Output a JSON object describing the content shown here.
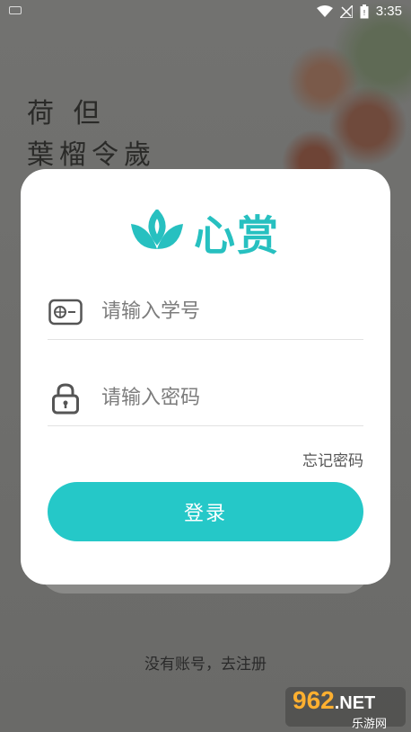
{
  "status_bar": {
    "time": "3:35"
  },
  "background": {
    "calligraphy_line1": "荷  但",
    "calligraphy_line2": "葉榴令歲"
  },
  "brand": {
    "name": "心赏",
    "color": "#27c0c0"
  },
  "login": {
    "student_id_placeholder": "请输入学号",
    "password_placeholder": "请输入密码",
    "forgot_password": "忘记密码",
    "login_button": "登录",
    "register_link": "没有账号，去注册",
    "button_color": "#25c8c8"
  },
  "watermark": {
    "number": "962",
    "net": ".NET",
    "site": "乐游网"
  },
  "icons": [
    "id-card-icon",
    "lock-icon",
    "lotus-logo-icon",
    "wifi-icon",
    "signal-icon",
    "battery-icon",
    "keyboard-icon"
  ]
}
